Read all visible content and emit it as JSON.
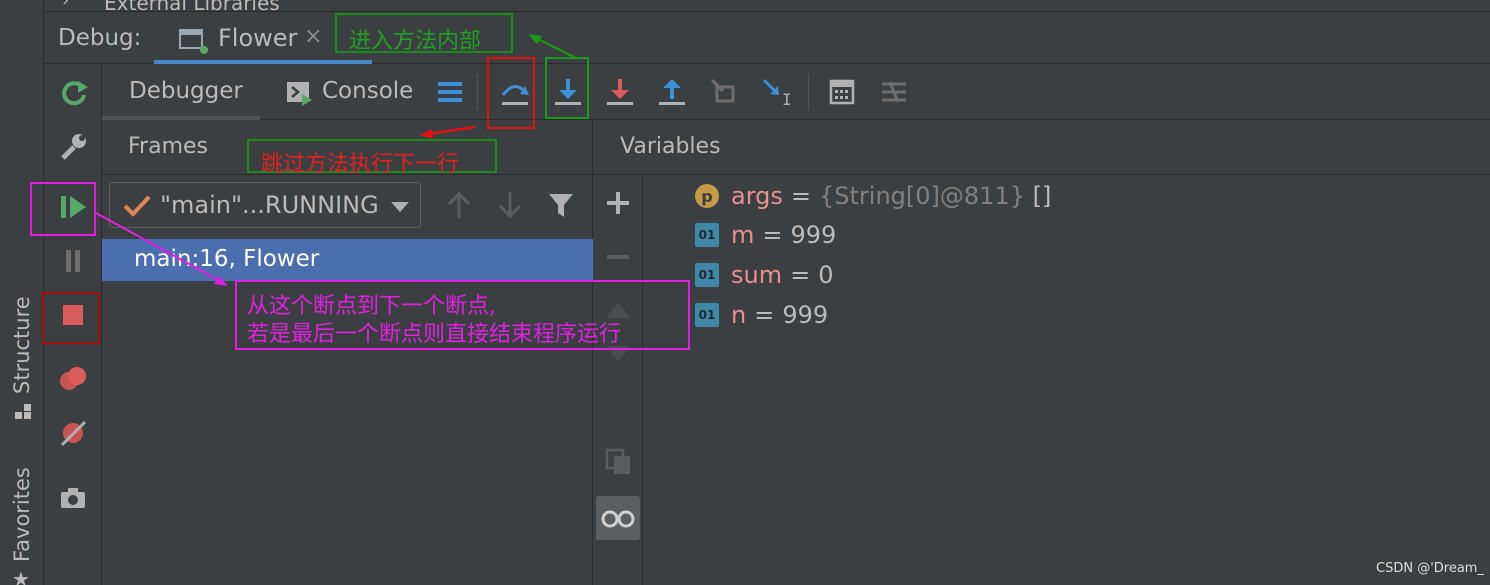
{
  "side_strip": {
    "structure_label": "Structure",
    "favorites_label": "Favorites"
  },
  "top_bar": {
    "external_libraries": "External Libraries"
  },
  "debug_bar": {
    "debug_label": "Debug:",
    "session_tab": "Flower",
    "close_glyph": "×"
  },
  "toolbar": {
    "tabs": [
      {
        "label": "Debugger"
      },
      {
        "label": "Console"
      }
    ],
    "buttons": [
      "layout-icon",
      "step-over-icon",
      "step-into-icon",
      "force-step-into-icon",
      "step-out-icon",
      "drop-frame-icon",
      "run-to-cursor-icon",
      "evaluate-expression-icon",
      "trace-stream-icon"
    ]
  },
  "frames": {
    "title": "Frames",
    "thread": "\"main\"...RUNNING",
    "rows": [
      {
        "label": "main:16, Flower"
      }
    ]
  },
  "variables": {
    "title": "Variables",
    "items": [
      {
        "icon": "p",
        "name": "args",
        "eq": "=",
        "value": "{String[0]@811}",
        "extra": " []"
      },
      {
        "icon": "01",
        "name": "m",
        "eq": "=",
        "value": "999",
        "extra": ""
      },
      {
        "icon": "01",
        "name": "sum",
        "eq": "=",
        "value": "0",
        "extra": ""
      },
      {
        "icon": "01",
        "name": "n",
        "eq": "=",
        "value": "999",
        "extra": ""
      }
    ]
  },
  "annotations": {
    "step_into": "进入方法内部",
    "step_over": "跳过方法执行下一行",
    "resume_line1": "从这个断点到下一个断点,",
    "resume_line2": "若是最后一个断点则直接结束程序运行"
  },
  "watermark": "CSDN @'Dream_",
  "colors": {
    "bg": "#3c3f41",
    "selection": "#4b6eaf",
    "green_annotation": "#1fa01f",
    "red_annotation": "#e02020",
    "magenta_annotation": "#e020e0",
    "var_name": "#e88f8f"
  }
}
